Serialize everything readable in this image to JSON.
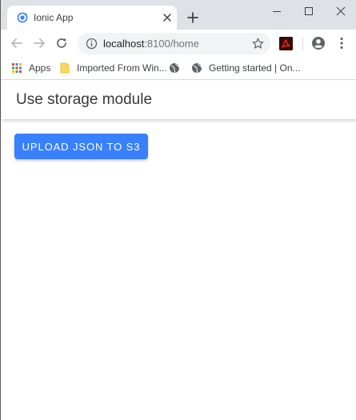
{
  "browser": {
    "tab": {
      "title": "Ionic App",
      "favicon": "ionic-favicon-icon"
    },
    "new_tab_icon": "plus-icon",
    "window_controls": [
      "minimize-icon",
      "maximize-icon",
      "close-icon"
    ],
    "toolbar": {
      "back_icon": "arrow-left-icon",
      "forward_icon": "arrow-right-icon",
      "reload_icon": "reload-icon",
      "url_host": "localhost",
      "url_rest": ":8100/home",
      "info_icon": "info-icon",
      "bookmark_star_icon": "star-icon",
      "extension_icon": "adobe-acrobat-icon",
      "profile_icon": "account-circle-icon",
      "menu_icon": "kebab-menu-icon"
    },
    "bookmarks": [
      {
        "label": "Apps",
        "icon": "apps-grid-icon"
      },
      {
        "label": "Imported From Win...",
        "icon": "folder-icon"
      },
      {
        "label": "",
        "icon": "globe-icon"
      },
      {
        "label": "Getting started | On...",
        "icon": "globe-icon"
      }
    ]
  },
  "app": {
    "header_title": "Use storage module",
    "upload_button_label": "UPLOAD JSON TO S3"
  },
  "colors": {
    "primary": "#3880ff",
    "tab_strip": "#dee1e6",
    "omnibox": "#f1f3f4"
  }
}
